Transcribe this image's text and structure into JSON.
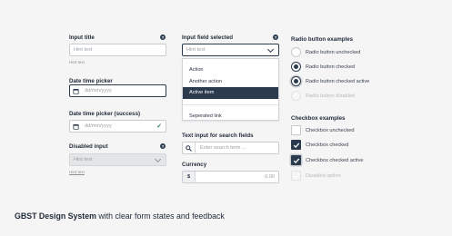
{
  "input_title": {
    "label": "Input title",
    "placeholder": "Hint text",
    "hint": "Hint text"
  },
  "date_picker": {
    "label": "Date time picker",
    "placeholder": "dd/mm/yyyy"
  },
  "date_picker_success": {
    "label": "Date time picker (success)",
    "placeholder": "dd/mm/yyyy"
  },
  "disabled_input": {
    "label": "Disabled input",
    "placeholder": "Hint text",
    "hint": "Hint text"
  },
  "selected_field": {
    "label": "Input field selected",
    "placeholder": "Hint text",
    "menu": [
      "Action",
      "Another action",
      "Active item"
    ],
    "menu_extra": "Seperated link",
    "active_index": 2
  },
  "search_field": {
    "label": "Text input for search fields",
    "placeholder": "Enter search term ..."
  },
  "currency": {
    "label": "Currency",
    "symbol": "$",
    "value": "0.00"
  },
  "radio_group": {
    "title": "Radio button examples",
    "items": [
      {
        "label": "Radio button unchecked",
        "state": "unchecked"
      },
      {
        "label": "Radio button checked",
        "state": "checked"
      },
      {
        "label": "Radio button checked active",
        "state": "checked-active"
      },
      {
        "label": "Radio button disabled",
        "state": "disabled"
      }
    ]
  },
  "checkbox_group": {
    "title": "Checkbox examples",
    "items": [
      {
        "label": "Checkbox unchecked",
        "state": "unchecked"
      },
      {
        "label": "Checkbox checked",
        "state": "checked"
      },
      {
        "label": "Checkbox checked active",
        "state": "checked-active"
      },
      {
        "label": "Disabled option",
        "state": "disabled"
      }
    ]
  },
  "footer": {
    "brand": "GBST Design System",
    "tagline": " with clear form states and feedback"
  },
  "icons": {
    "help": "?",
    "check": "✓"
  },
  "colors": {
    "primary": "#2c3a4e",
    "success": "#2e7d4f",
    "background": "#f5f5f5"
  }
}
